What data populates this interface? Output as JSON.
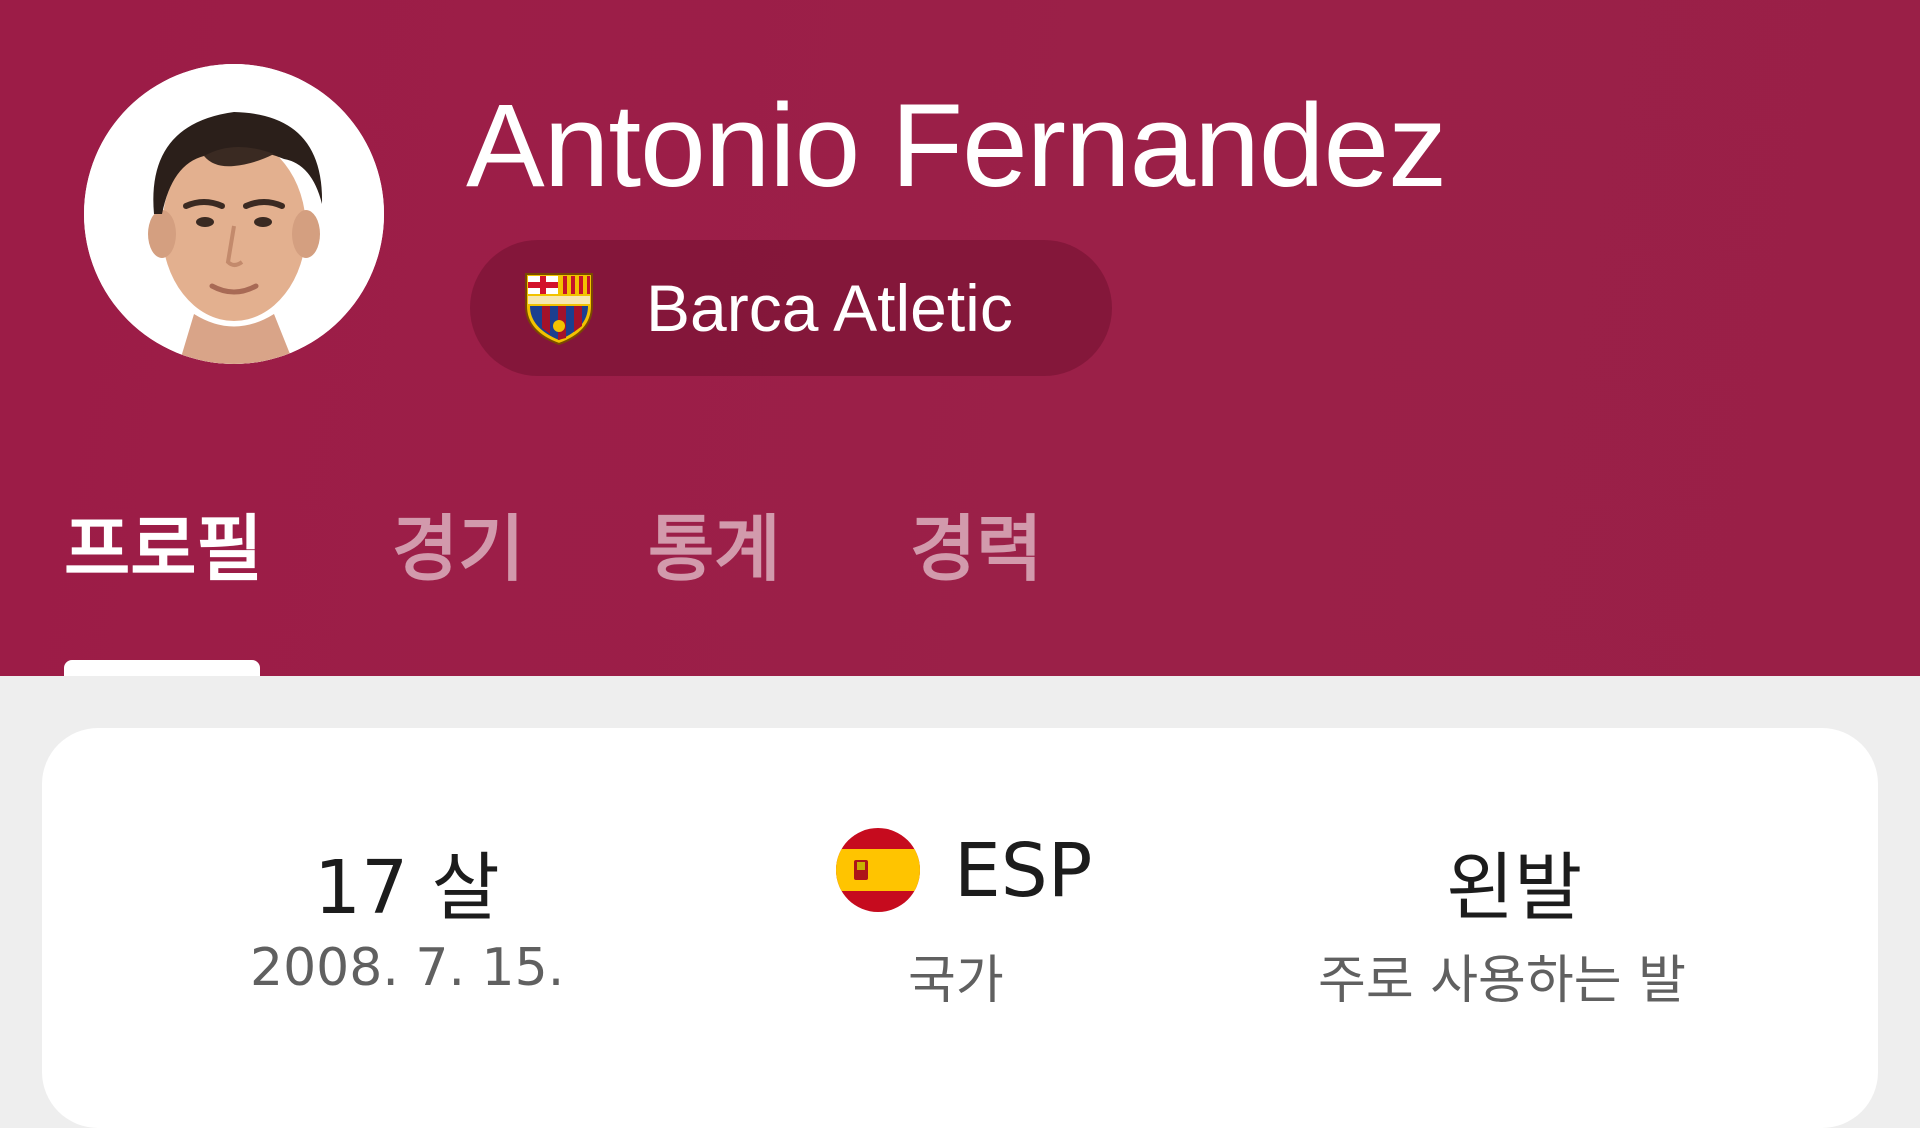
{
  "player": {
    "name": "Antonio Fernandez",
    "team": "Barca Atletic"
  },
  "tabs": [
    {
      "label": "프로필",
      "active": true
    },
    {
      "label": "경기",
      "active": false
    },
    {
      "label": "통계",
      "active": false
    },
    {
      "label": "경력",
      "active": false
    }
  ],
  "stats": {
    "age": {
      "value": "17 살",
      "label": "2008. 7. 15."
    },
    "nation": {
      "value": "ESP",
      "label": "국가",
      "flag_icon": "spain-flag-icon"
    },
    "foot": {
      "value": "왼발",
      "label": "주로 사용하는 발"
    }
  },
  "colors": {
    "header": "#9b1e47",
    "chip": "#7d1737",
    "card": "#ffffff",
    "page": "#eeeeee"
  }
}
